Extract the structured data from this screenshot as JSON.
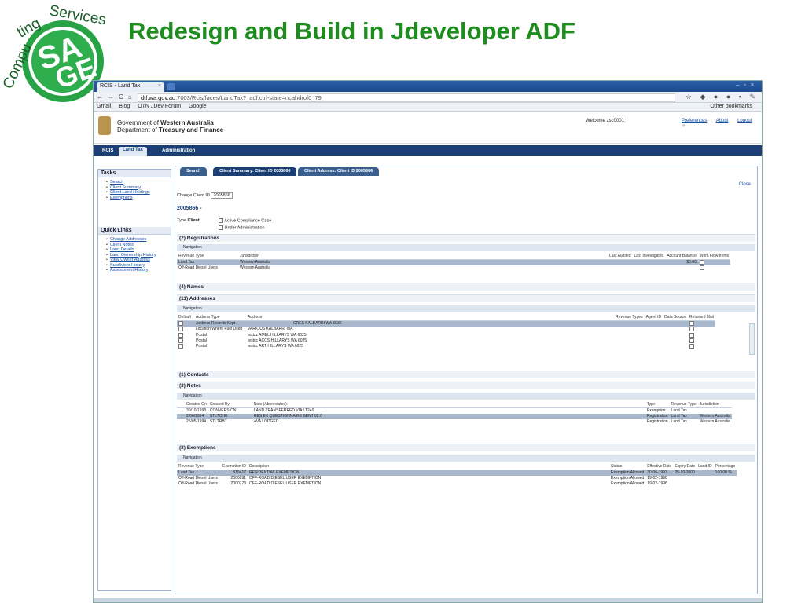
{
  "slide": {
    "title": "Redesign and Build in Jdeveloper ADF",
    "logo_text": "Computing Services SAGE"
  },
  "browser": {
    "tab_label": "RCIS - Land Tax",
    "url_host": "dtf.wa.gov.au",
    "url_path": ":7003/Rcis/faces/LandTax?_adf.ctrl-state=ncahdrof0_79",
    "bookmarks": [
      "Gmail",
      "Blog",
      "OTN JDev Forum",
      "Google"
    ],
    "other_bookmarks": "Other bookmarks"
  },
  "header": {
    "org_line1": "Government of ",
    "org_line1_bold": "Western Australia",
    "org_line2": "Department of ",
    "org_line2_bold": "Treasury and Finance",
    "welcome": "Welcome  zsc0001",
    "links": [
      "Preferences",
      "About",
      "Logout"
    ]
  },
  "appnav": {
    "tabs": [
      "RCIS",
      "Land Tax",
      "Administration"
    ]
  },
  "sidebar": {
    "tasks_title": "Tasks",
    "tasks": [
      "Search",
      "Client Summary",
      "Client Land Holdings",
      "Exemptions"
    ],
    "quick_title": "Quick Links",
    "quick": [
      "Change Addresses",
      "Client Notes",
      "Land Details",
      "Land Ownership History",
      "View Owner Address",
      "Subdivisor History",
      "Assessment History"
    ]
  },
  "content": {
    "tabs": [
      "Search",
      "Client Summary: Client ID 2005866",
      "Client Address: Client ID 2005866"
    ],
    "close": "Close",
    "change_client_label": "Change Client ID",
    "client_id_value": "2005866",
    "client_heading": "2005866 -",
    "type_label": "Type",
    "type_value": "Client",
    "active_compliance": "Active Compliance Case",
    "under_admin": "Under Administration",
    "navigation": "Navigation"
  },
  "registrations": {
    "title": "(2) Registrations",
    "headers": [
      "Revenue Type",
      "Jurisdiction",
      "Last Audited",
      "Last Investigated",
      "Account Balance",
      "Work Flow Items"
    ],
    "rows": [
      [
        "Land Tax",
        "Western Australia",
        "",
        "",
        "$0.00",
        ""
      ],
      [
        "Off-Road Diesel Users",
        "Western Australia",
        "",
        "",
        "",
        ""
      ]
    ]
  },
  "names": {
    "title": "(4) Names"
  },
  "addresses": {
    "title": "(11) Addresses",
    "headers": [
      "Default",
      "Address Type",
      "Address",
      "Revenue Types",
      "Agent ID",
      "Data Source",
      "Returned Mail"
    ],
    "rows": [
      [
        "",
        "Address Records Kept",
        "CRES KALBARRI WA 6536",
        "",
        "",
        "",
        ""
      ],
      [
        "",
        "Location Where Fuel Used",
        "VARIOUS KALBARRI WA",
        "",
        "",
        "",
        ""
      ],
      [
        "",
        "Postal",
        "testzz AMBL HILLARYS WA 6025",
        "",
        "",
        "",
        ""
      ],
      [
        "",
        "Postal",
        "testcc ACCS HILLARYS WA 6025",
        "",
        "",
        "",
        ""
      ],
      [
        "",
        "Postal",
        "testcc ART HILLARYS WA 6025",
        "",
        "",
        "",
        ""
      ]
    ]
  },
  "contacts": {
    "title": "(1) Contacts"
  },
  "notes": {
    "title": "(3) Notes",
    "headers": [
      "Created On",
      "Created By",
      "Note (Abbreviated)",
      "Type",
      "Revenue Type",
      "Jurisdiction"
    ],
    "rows": [
      [
        "30/10/1998",
        "CONVERSION",
        "LAND TRANSFERRED VIA LT240",
        "Exemption",
        "Land Tax",
        ""
      ],
      [
        "2/06/1994",
        "STLTCHU",
        "RES EX QUESTIONNAIRE SENT 02.0",
        "Registration",
        "Land Tax",
        "Western Australia"
      ],
      [
        "25/05/1994",
        "STLTRBT",
        "AVA LODGED",
        "Registration",
        "Land Tax",
        "Western Australia"
      ]
    ]
  },
  "exemptions": {
    "title": "(3) Exemptions",
    "headers": [
      "Revenue Type",
      "Exemption ID",
      "Description",
      "Status",
      "Effective Date",
      "Expiry Date",
      "Land ID",
      "Percentage"
    ],
    "rows": [
      [
        "Land Tax",
        "819417",
        "RESIDENTIAL EXEMPTION",
        "Exemption Allowed",
        "30-06-1993",
        "25-10-2000",
        "",
        "100.00 %"
      ],
      [
        "Off-Road Diesel Users",
        "2000891",
        "OFF-ROAD DIESEL USER EXEMPTION",
        "Exemption Allowed",
        "19-02-1998",
        "",
        "",
        " "
      ],
      [
        "Off-Road Diesel Users",
        "2000773",
        "OFF-ROAD DIESEL USER EXEMPTION",
        "Exemption Allowed",
        "19-02-1998",
        "",
        "",
        ""
      ]
    ]
  },
  "colors": {
    "title_green": "#1e8c1e",
    "nav_blue": "#1b3f75",
    "selected_row": "#a9b8cd"
  },
  "icons": [
    "back-icon",
    "forward-icon",
    "reload-icon",
    "home-icon",
    "star-icon",
    "close-icon",
    "expand-icon",
    "navigation-icon",
    "checkbox-icon",
    "spinner-icon"
  ]
}
